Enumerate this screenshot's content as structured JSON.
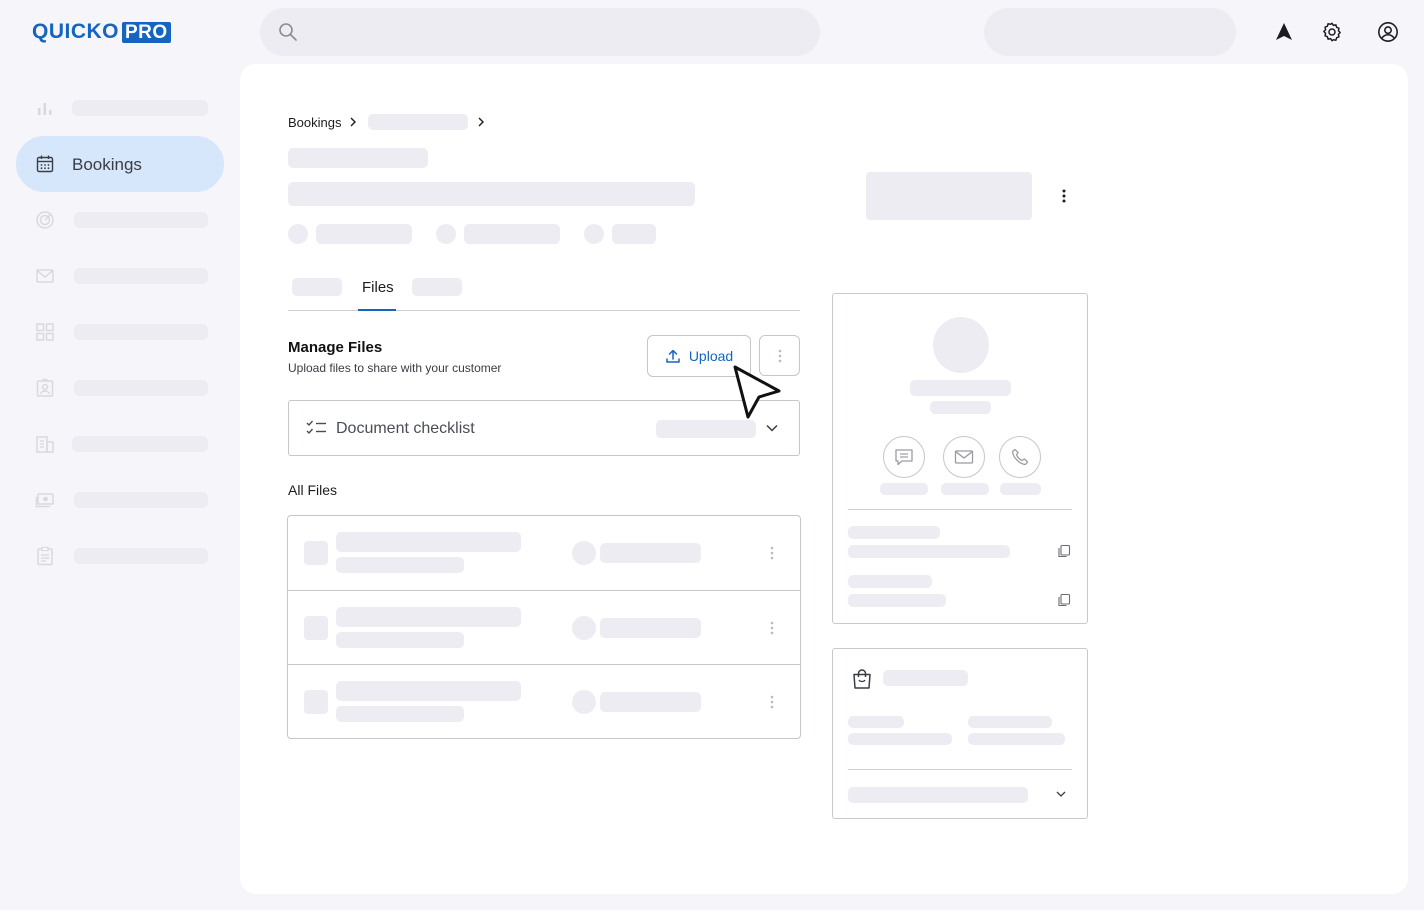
{
  "brand": {
    "name_part1": "QUICKO",
    "name_part2": "PRO"
  },
  "sidebar": {
    "items": [
      {
        "icon": "bar-chart-icon",
        "label": ""
      },
      {
        "icon": "calendar-icon",
        "label": "Bookings"
      },
      {
        "icon": "target-icon",
        "label": ""
      },
      {
        "icon": "mail-icon",
        "label": ""
      },
      {
        "icon": "grid-icon",
        "label": ""
      },
      {
        "icon": "badge-icon",
        "label": ""
      },
      {
        "icon": "building-icon",
        "label": ""
      },
      {
        "icon": "cash-icon",
        "label": ""
      },
      {
        "icon": "clipboard-icon",
        "label": ""
      }
    ]
  },
  "breadcrumb": {
    "root": "Bookings"
  },
  "tabs": {
    "active": "Files"
  },
  "manage_files": {
    "title": "Manage Files",
    "subtitle": "Upload files to share with your customer",
    "upload_label": "Upload"
  },
  "checklist": {
    "label": "Document checklist"
  },
  "all_files": {
    "title": "All Files"
  },
  "colors": {
    "accent": "#1565c0",
    "active_nav": "#d6e6fb",
    "placeholder": "#ececf2"
  }
}
